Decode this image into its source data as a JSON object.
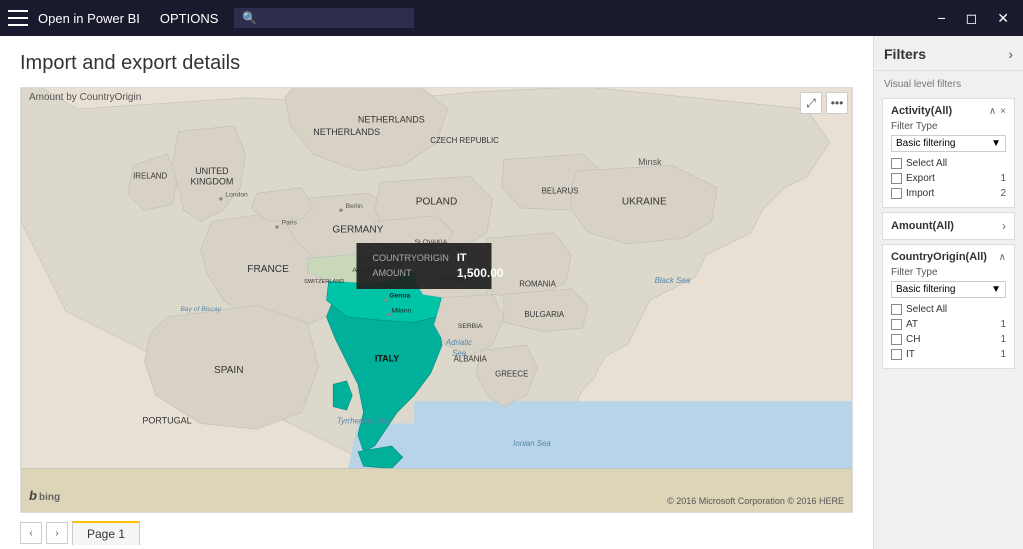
{
  "titlebar": {
    "app_name": "Open in Power BI",
    "options_label": "OPTIONS",
    "search_placeholder": "🔍",
    "window_buttons": [
      "minimize",
      "restore",
      "close"
    ]
  },
  "page": {
    "title": "Import and export details",
    "map_label": "Amount by CountryOrigin"
  },
  "map_tooltip": {
    "row1_key": "COUNTRYORIGIN",
    "row1_val": "IT",
    "row2_key": "AMOUNT",
    "row2_val": "1,500.00"
  },
  "map_controls": {
    "expand": "⤢",
    "more": "···"
  },
  "map_copyright": "© 2016 Microsoft Corporation  © 2016 HERE",
  "bing": "b bing",
  "page_nav": {
    "prev_label": "‹",
    "next_label": "›",
    "page_label": "Page 1"
  },
  "filters": {
    "title": "Filters",
    "expand_icon": "›",
    "visual_level_label": "Visual level filters",
    "filter_cards": [
      {
        "id": "activity",
        "title": "Activity(All)",
        "filter_type_label": "Filter Type",
        "filter_type_value": "Basic filtering",
        "collapse_icon": "∧",
        "close_icon": "×",
        "items": [
          {
            "label": "Select All",
            "checked": false,
            "count": ""
          },
          {
            "label": "Export",
            "checked": false,
            "count": "1"
          },
          {
            "label": "Import",
            "checked": false,
            "count": "2"
          }
        ]
      },
      {
        "id": "amount",
        "title": "Amount(All)",
        "collapsed": true,
        "items": []
      },
      {
        "id": "countryorigin",
        "title": "CountryOrigin(All)",
        "filter_type_label": "Filter Type",
        "filter_type_value": "Basic filtering",
        "collapse_icon": "∧",
        "close_icon": "",
        "items": [
          {
            "label": "Select All",
            "checked": false,
            "count": ""
          },
          {
            "label": "AT",
            "checked": false,
            "count": "1"
          },
          {
            "label": "CH",
            "checked": false,
            "count": "1"
          },
          {
            "label": "IT",
            "checked": false,
            "count": "1"
          }
        ]
      }
    ]
  }
}
